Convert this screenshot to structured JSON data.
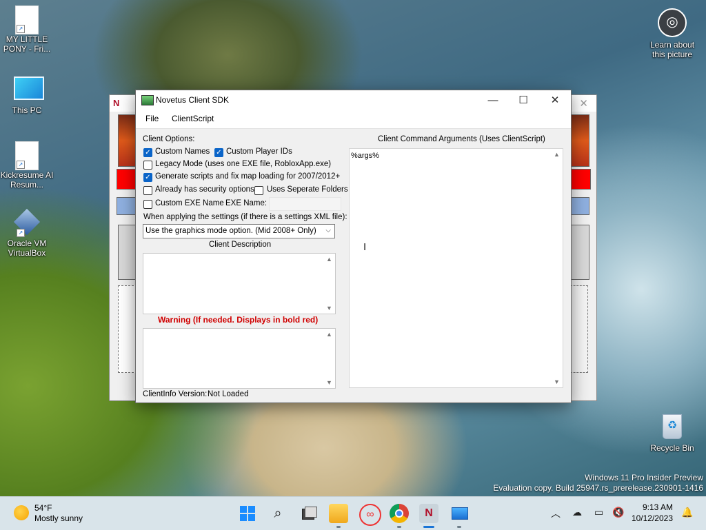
{
  "desktop": {
    "icons": [
      {
        "label": "MY LITTLE PONY - Fri..."
      },
      {
        "label": "This PC"
      },
      {
        "label": "Kickresume AI Resum..."
      },
      {
        "label": "Oracle VM VirtualBox"
      },
      {
        "label": "Learn about this picture"
      },
      {
        "label": "Recycle Bin"
      }
    ],
    "watermark": {
      "line1": "Windows 11 Pro Insider Preview",
      "line2": "Evaluation copy. Build 25947.rs_prerelease.230901-1416"
    }
  },
  "window": {
    "title": "Novetus Client SDK",
    "minimize_glyph": "—",
    "maximize_glyph": "☐",
    "close_glyph": "✕",
    "menu": [
      "File",
      "ClientScript"
    ],
    "client_options_label": "Client Options:",
    "options": {
      "custom_names": {
        "label": "Custom Names",
        "checked": true
      },
      "custom_player_ids": {
        "label": "Custom Player IDs",
        "checked": true
      },
      "legacy_mode": {
        "label": "Legacy Mode (uses one EXE file, RobloxApp.exe)",
        "checked": false
      },
      "generate_scripts": {
        "label": "Generate scripts and fix map loading for 2007/2012+",
        "checked": true
      },
      "security_options": {
        "label": "Already has security options",
        "checked": false
      },
      "separate_folders": {
        "label": "Uses Seperate Folders",
        "checked": false
      },
      "custom_exe": {
        "label": "Custom EXE Name",
        "checked": false
      }
    },
    "exe_name_label": "EXE Name:",
    "exe_name_value": "",
    "settings_label": "When applying the settings (if there is a settings XML file):",
    "graphics_mode_selected": "Use the graphics mode option. (Mid 2008+ Only)",
    "client_description_label": "Client Description",
    "client_description_value": "",
    "warning_label": "Warning (If needed. Displays in bold red)",
    "warning_value": "",
    "clientinfo_version_label": "ClientInfo Version:",
    "clientinfo_version_value": "Not Loaded",
    "command_args_label": "Client Command Arguments (Uses ClientScript)",
    "command_args_value": "%args%"
  },
  "taskbar": {
    "weather_temp": "54°F",
    "weather_desc": "Mostly sunny",
    "time": "9:13 AM",
    "date": "10/12/2023"
  }
}
